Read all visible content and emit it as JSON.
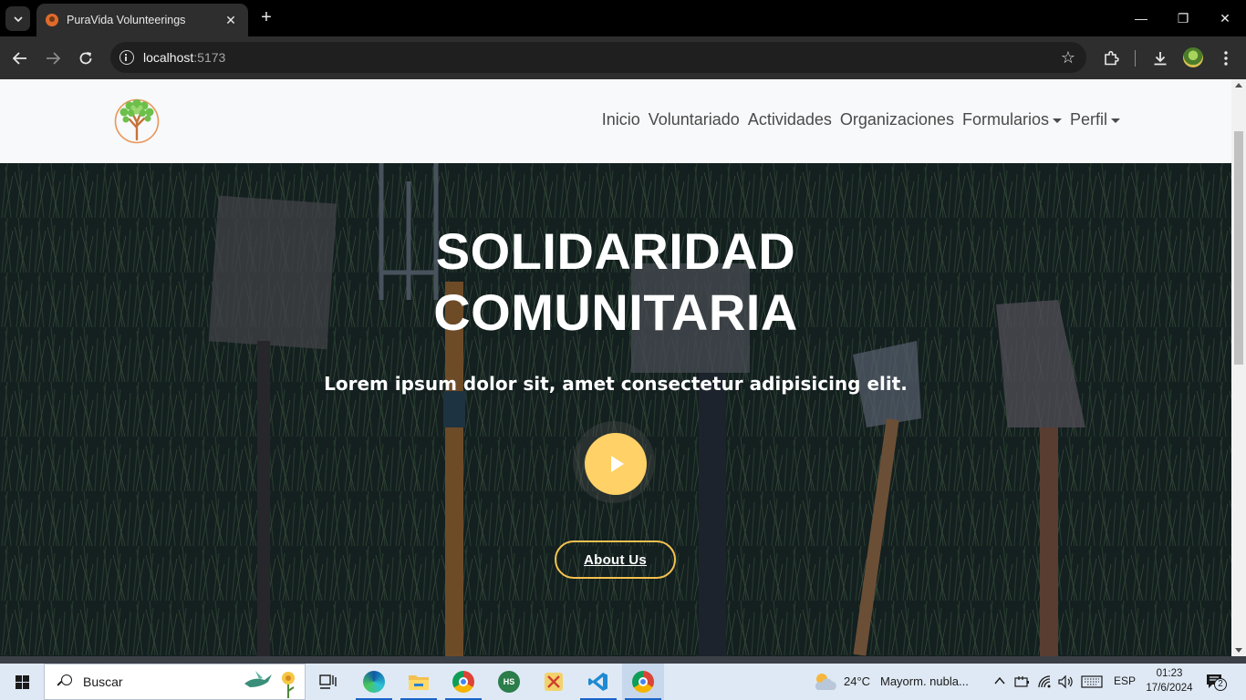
{
  "browser": {
    "tab_title": "PuraVida Volunteerings",
    "tab_close": "✕",
    "new_tab": "+",
    "url_host": "localhost",
    "url_port": ":5173",
    "window_controls": {
      "minimize": "—",
      "restore": "❐",
      "close": "✕"
    }
  },
  "site": {
    "nav": [
      {
        "label": "Inicio"
      },
      {
        "label": "Voluntariado"
      },
      {
        "label": "Actividades"
      },
      {
        "label": "Organizaciones"
      },
      {
        "label": "Formularios",
        "dropdown": true
      },
      {
        "label": "Perfil",
        "dropdown": true
      }
    ],
    "hero": {
      "title_line1": "SOLIDARIDAD",
      "title_line2": "COMUNITARIA",
      "subtitle": "Lorem ipsum dolor sit, amet consectetur adipisicing elit.",
      "about_label": "About Us"
    },
    "colors": {
      "accent_yellow": "#ffd166",
      "header_bg": "#f8f9fa"
    }
  },
  "taskbar": {
    "search_placeholder": "Buscar",
    "weather_temp": "24°C",
    "weather_desc": "Mayorm. nubla...",
    "language": "ESP",
    "time": "01:23",
    "date": "17/6/2024",
    "notifications": "2",
    "apps": [
      "task-view-icon",
      "edge-icon",
      "file-explorer-icon",
      "chrome-icon",
      "hs-app-icon",
      "tool-app-icon",
      "vscode-icon",
      "chrome-profile-icon"
    ]
  }
}
